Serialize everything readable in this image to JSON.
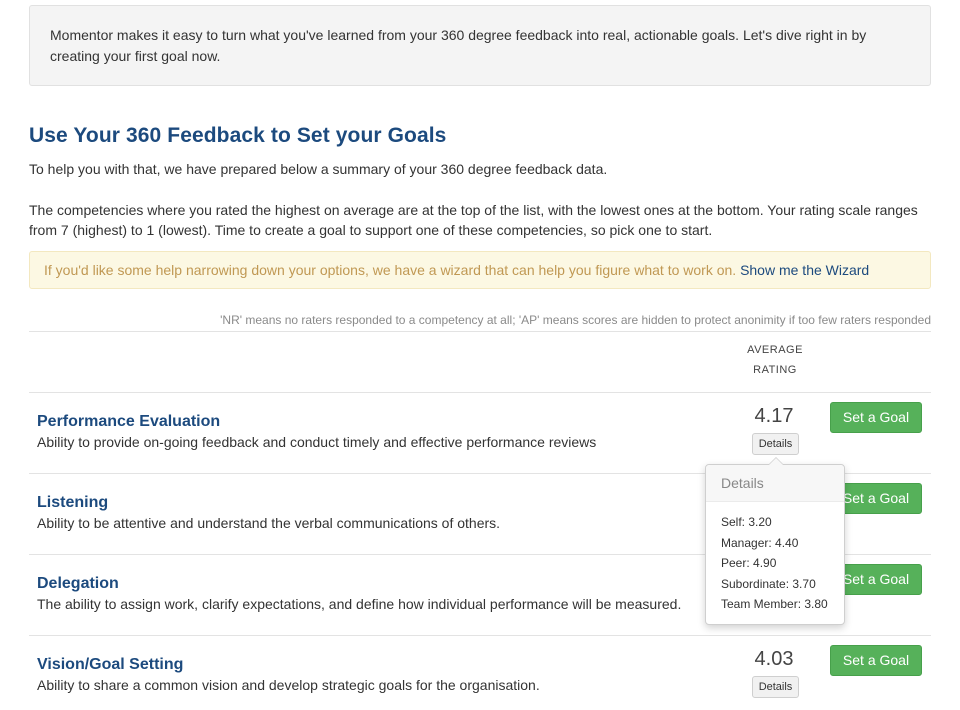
{
  "intro": {
    "text": "Momentor makes it easy to turn what you've learned from your 360 degree feedback into real, actionable goals. Let's dive right in by creating your first goal now."
  },
  "heading": "Use Your 360 Feedback to Set your Goals",
  "paragraphs": [
    "To help you with that, we have prepared below a summary of your 360 degree feedback data.",
    "The competencies where you rated the highest on average are at the top of the list, with the lowest ones at the bottom. Your rating scale ranges from 7 (highest) to 1 (lowest). Time to create a goal to support one of these competencies, so pick one to start."
  ],
  "wizard": {
    "text": "If you'd like some help narrowing down your options, we have a wizard that can help you figure what to work on.",
    "link": "Show me the Wizard"
  },
  "legend_note": "'NR' means no raters responded to a competency at all; 'AP' means scores are hidden to protect anonimity if too few raters responded",
  "table": {
    "header_line1": "AVERAGE",
    "header_line2": "RATING",
    "details_label": "Details",
    "goal_label": "Set a Goal",
    "rows": [
      {
        "title": "Performance Evaluation",
        "desc": "Ability to provide on-going feedback and conduct timely and effective performance reviews",
        "rating": "4.17"
      },
      {
        "title": "Listening",
        "desc": "Ability to be attentive and understand the verbal communications of others.",
        "rating": ""
      },
      {
        "title": "Delegation",
        "desc": "The ability to assign work, clarify expectations, and define how individual performance will be measured.",
        "rating": ""
      },
      {
        "title": "Vision/Goal Setting",
        "desc": "Ability to share a common vision and develop strategic goals for the organisation.",
        "rating": "4.03"
      }
    ]
  },
  "popover": {
    "title": "Details",
    "lines": [
      "Self: 3.20",
      "Manager: 4.40",
      "Peer: 4.90",
      "Subordinate: 3.70",
      "Team Member: 3.80"
    ]
  }
}
